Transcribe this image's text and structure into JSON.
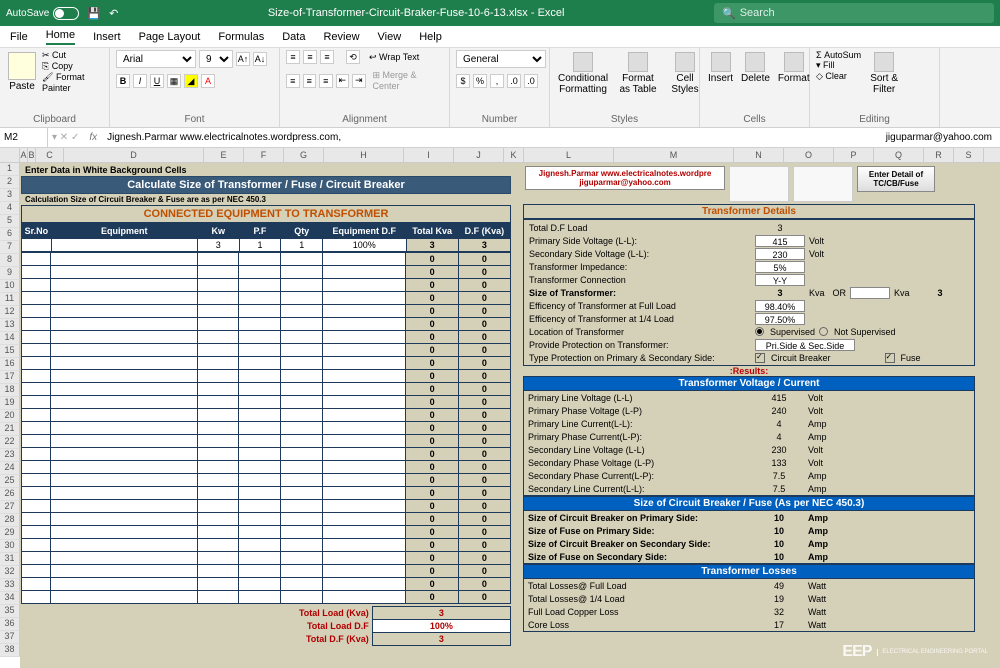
{
  "titlebar": {
    "autosave": "AutoSave",
    "filename": "Size-of-Transformer-Circuit-Braker-Fuse-10-6-13.xlsx - Excel",
    "search": "Search"
  },
  "menu": {
    "file": "File",
    "home": "Home",
    "insert": "Insert",
    "pagelayout": "Page Layout",
    "formulas": "Formulas",
    "data": "Data",
    "review": "Review",
    "view": "View",
    "help": "Help"
  },
  "ribbon": {
    "clipboard": {
      "label": "Clipboard",
      "paste": "Paste",
      "cut": "Cut",
      "copy": "Copy",
      "painter": "Format Painter"
    },
    "font": {
      "label": "Font",
      "name": "Arial",
      "size": "9"
    },
    "alignment": {
      "label": "Alignment",
      "wrap": "Wrap Text",
      "merge": "Merge & Center"
    },
    "number": {
      "label": "Number",
      "format": "General"
    },
    "styles": {
      "label": "Styles",
      "cond": "Conditional Formatting",
      "table": "Format as Table",
      "cell": "Cell Styles"
    },
    "cells": {
      "label": "Cells",
      "insert": "Insert",
      "delete": "Delete",
      "format": "Format"
    },
    "editing": {
      "label": "Editing",
      "autosum": "AutoSum",
      "fill": "Fill",
      "clear": "Clear",
      "sort": "Sort & Filter"
    }
  },
  "formulabar": {
    "cell": "M2",
    "fx": "fx",
    "value": "Jignesh.Parmar www.electricalnotes.wordpress.com,",
    "value2": "jiguparmar@yahoo.com"
  },
  "cols": [
    "A",
    "B",
    "C",
    "D",
    "E",
    "F",
    "G",
    "H",
    "I",
    "J",
    "K",
    "L",
    "M",
    "N",
    "O",
    "P",
    "Q",
    "R",
    "S"
  ],
  "sheet": {
    "enter_note": "Enter Data in White Background Cells",
    "main_title": "Calculate Size of Transformer / Fuse / Circuit Breaker",
    "calc_note": "Calculation Size of Circuit Breaker & Fuse are as per NEC 450.3",
    "sect_connected": "CONNECTED EQUIPMENT TO TRANSFORMER",
    "th": {
      "srno": "Sr.No",
      "equip": "Equipment",
      "kw": "Kw",
      "pf": "P.F",
      "qty": "Qty",
      "edf": "Equipment D.F",
      "tkva": "Total Kva",
      "dfkva": "D.F (Kva)"
    },
    "row1": {
      "kw": "3",
      "pf": "1",
      "qty": "1",
      "edf": "100%",
      "tkva": "3",
      "dfkva": "3"
    },
    "zero": "0",
    "tot_load": "Total Load (Kva)",
    "tot_load_v": "3",
    "tot_df": "Total Load D.F",
    "tot_df_v": "100%",
    "tot_dfkva": "Total D.F (Kva)",
    "tot_dfkva_v": "3",
    "credit1": "Jignesh.Parmar www.electricalnotes.wordpre",
    "credit2": "jiguparmar@yahoo.com",
    "btn_detail": "Enter Detail of TC/CB/Fuse",
    "sect_details": "Transformer Details",
    "d": {
      "totdf": "Total D.F Load",
      "totdf_v": "3",
      "pv": "Primary Side Voltage (L-L):",
      "pv_v": "415",
      "pv_u": "Volt",
      "sv": "Secondary  Side Voltage (L-L):",
      "sv_v": "230",
      "sv_u": "Volt",
      "imp": "Transformer Impedance:",
      "imp_v": "5%",
      "conn": "Transformer Connection",
      "conn_v": "Y-Y",
      "size": "Size of Transformer:",
      "size_v": "3",
      "size_u": "Kva",
      "or": "OR",
      "size_u2": "Kva",
      "size_r": "3",
      "efl": "Efficency of Transformer at Full Load",
      "efl_v": "98.40%",
      "eql": "Efficency of Transformer at 1/4 Load",
      "eql_v": "97.50%",
      "loc": "Location of Transformer",
      "sup": "Supervised",
      "nsup": "Not Supervised",
      "prot": "Provide Protection on Transformer:",
      "prot_v": "Pri.Side & Sec.Side",
      "type": "Type Protection on Primary & Secondary Side:",
      "cb": "Circuit Breaker",
      "fuse": "Fuse"
    },
    "results": ":Results:",
    "sect_vc": "Transformer Voltage / Current",
    "vc": {
      "plv": "Primary Line Voltage (L-L)",
      "plv_v": "415",
      "plv_u": "Volt",
      "ppv": "Primary Phase Voltage (L-P)",
      "ppv_v": "240",
      "ppv_u": "Volt",
      "plc": "Primary Line Current(L-L):",
      "plc_v": "4",
      "plc_u": "Amp",
      "ppc": "Primary Phase Current(L-P):",
      "ppc_v": "4",
      "ppc_u": "Amp",
      "slv": "Secondary Line Voltage (L-L)",
      "slv_v": "230",
      "slv_u": "Volt",
      "spv": "Secondary Phase Voltage (L-P)",
      "spv_v": "133",
      "spv_u": "Volt",
      "spc": "Secondary Phase Current(L-P):",
      "spc_v": "7.5",
      "spc_u": "Amp",
      "slc": "Secondary Line Current(L-L):",
      "slc_v": "7.5",
      "slc_u": "Amp"
    },
    "sect_cb": "Size of Circuit Breaker / Fuse (As per NEC 450.3)",
    "cb": {
      "cbp": "Size of Circuit Breaker on Primary Side:",
      "cbp_v": "10",
      "u": "Amp",
      "fp": "Size of Fuse on Primary Side:",
      "fp_v": "10",
      "cbs": "Size of Circuit Breaker on Secondary Side:",
      "cbs_v": "10",
      "fs": "Size of Fuse on Secondary Side:",
      "fs_v": "10"
    },
    "sect_loss": "Transformer Losses",
    "loss": {
      "fl": "Total Losses@ Full Load",
      "fl_v": "49",
      "u": "Watt",
      "ql": "Total Losses@ 1/4 Load",
      "ql_v": "19",
      "cu": "Full Load Copper Loss",
      "cu_v": "32",
      "core": "Core Loss",
      "core_v": "17"
    }
  },
  "watermark": {
    "logo": "EEP",
    "text": "ELECTRICAL ENGINEERING PORTAL"
  }
}
